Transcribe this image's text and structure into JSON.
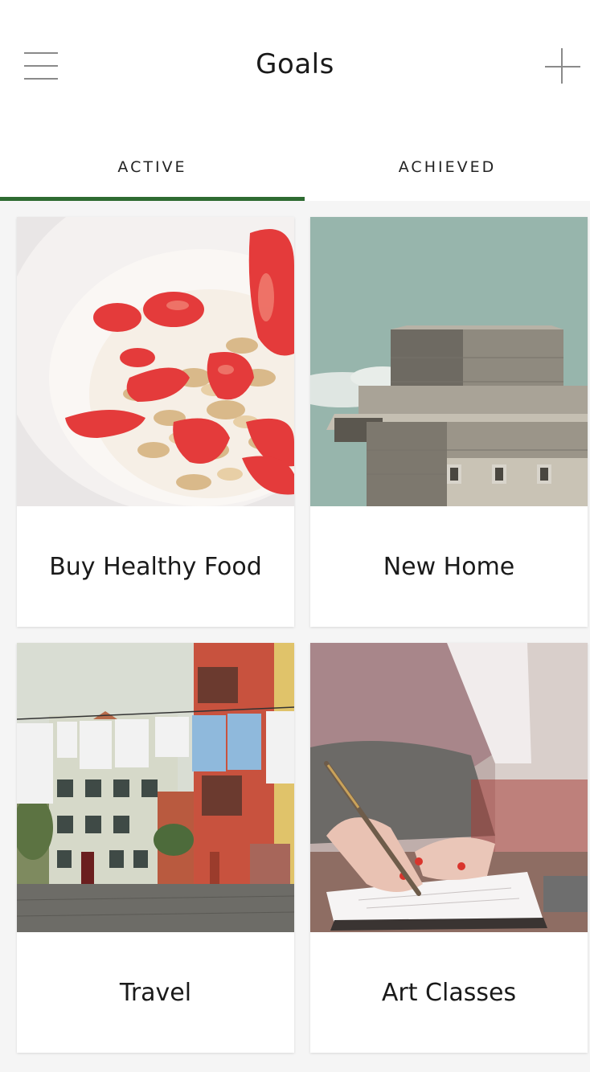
{
  "header": {
    "title": "Goals",
    "menu_icon": "hamburger-menu-icon",
    "add_icon": "plus-icon"
  },
  "tabs": [
    {
      "label": "ACTIVE",
      "selected": true
    },
    {
      "label": "ACHIEVED",
      "selected": false
    }
  ],
  "colors": {
    "accent": "#2e6b31",
    "background": "#f5f5f5",
    "card": "#ffffff"
  },
  "goals": [
    {
      "title": "Buy Healthy Food",
      "image": "yogurt-granola-strawberries-photo"
    },
    {
      "title": "New Home",
      "image": "concrete-building-photo"
    },
    {
      "title": "Travel",
      "image": "street-with-laundry-photo"
    },
    {
      "title": "Art Classes",
      "image": "person-writing-notebook-photo"
    }
  ]
}
